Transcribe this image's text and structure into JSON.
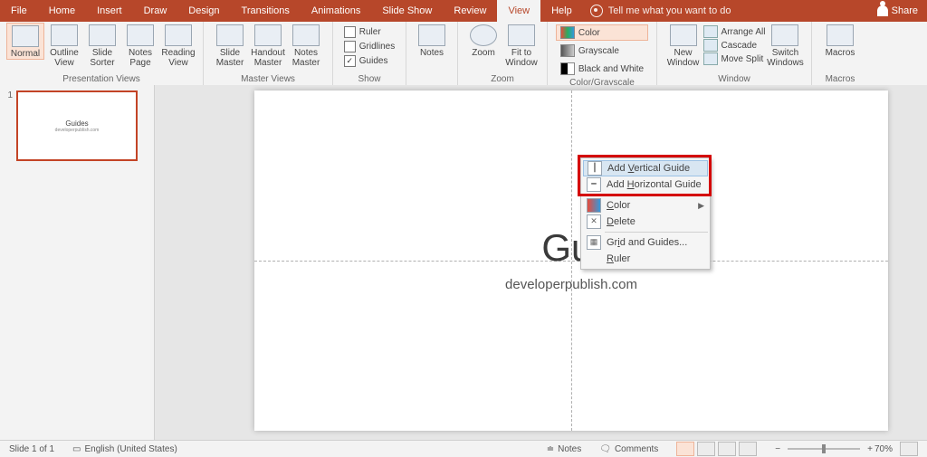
{
  "tabs": {
    "file": "File",
    "home": "Home",
    "insert": "Insert",
    "draw": "Draw",
    "design": "Design",
    "transitions": "Transitions",
    "animations": "Animations",
    "slideshow": "Slide Show",
    "review": "Review",
    "view": "View",
    "help": "Help"
  },
  "tell": "Tell me what you want to do",
  "share": "Share",
  "ribbon": {
    "presentation_views": {
      "label": "Presentation Views",
      "normal": "Normal",
      "outline": "Outline View",
      "sorter": "Slide Sorter",
      "notes_page": "Notes Page",
      "reading": "Reading View"
    },
    "master_views": {
      "label": "Master Views",
      "slide": "Slide Master",
      "handout": "Handout Master",
      "notes": "Notes Master"
    },
    "show": {
      "label": "Show",
      "ruler": "Ruler",
      "gridlines": "Gridlines",
      "guides": "Guides",
      "guides_checked": "✓"
    },
    "notes": {
      "label": "",
      "notes": "Notes"
    },
    "zoom": {
      "label": "Zoom",
      "zoom": "Zoom",
      "fit": "Fit to Window"
    },
    "color": {
      "label": "Color/Grayscale",
      "color": "Color",
      "gray": "Grayscale",
      "bw": "Black and White"
    },
    "window": {
      "label": "Window",
      "new": "New Window",
      "arrange": "Arrange All",
      "cascade": "Cascade",
      "split": "Move Split",
      "switch": "Switch Windows"
    },
    "macros": {
      "label": "Macros",
      "macros": "Macros"
    }
  },
  "thumb": {
    "num": "1",
    "title": "Guides",
    "sub": "developerpublish.com"
  },
  "slide": {
    "title_visible": "Gui",
    "sub": "developerpublish.com"
  },
  "ctx": {
    "add_v": "Add Vertical Guide",
    "add_v_ul": "V",
    "add_h": "Add Horizontal Guide",
    "add_h_ul": "H",
    "color": "Color",
    "color_ul": "C",
    "delete": "Delete",
    "delete_ul": "D",
    "grid": "Grid and Guides...",
    "grid_ul": "i",
    "ruler": "Ruler",
    "ruler_ul": "R"
  },
  "status": {
    "slide": "Slide 1 of 1",
    "lang": "English (United States)",
    "notes": "Notes",
    "comments": "Comments",
    "zoom": "70%"
  }
}
